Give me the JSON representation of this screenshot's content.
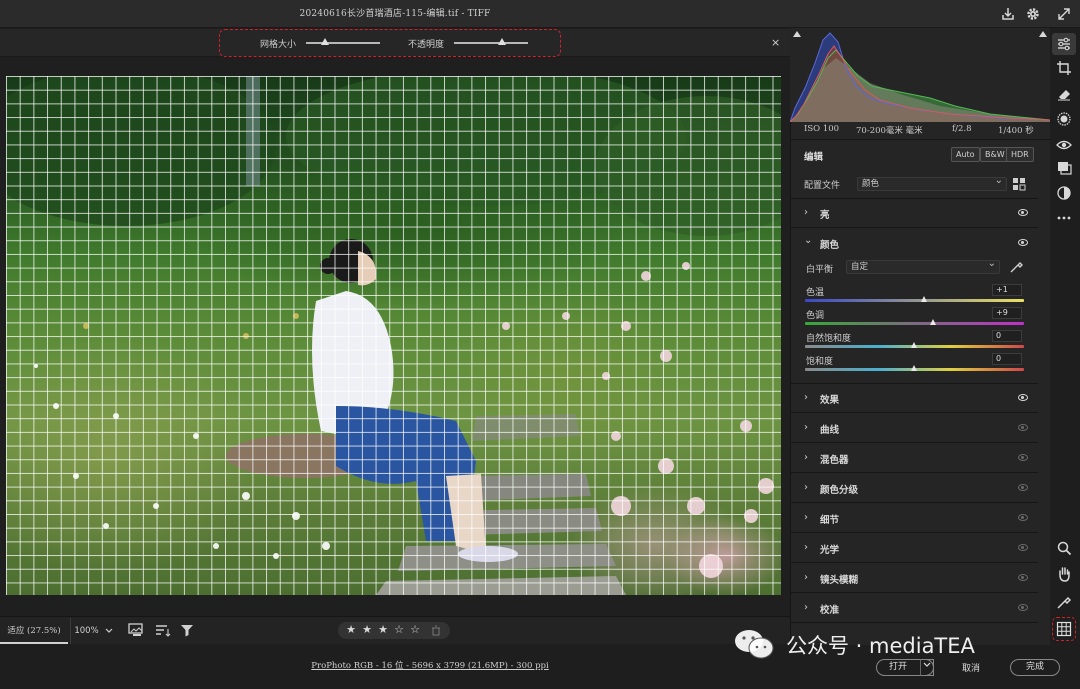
{
  "window": {
    "title": "20240616长沙首瑞酒店-115-编辑.tif -  TIFF"
  },
  "overlay": {
    "grid_size_label": "网格大小",
    "grid_size_value": 0.25,
    "opacity_label": "不透明度",
    "opacity_value": 0.65,
    "close_glyph": "×"
  },
  "histogram": {
    "iso": "ISO 100",
    "lens": "70-200毫米 毫米",
    "aperture": "f/2.8",
    "shutter": "1/400 秒"
  },
  "edit": {
    "title": "编辑",
    "auto": "Auto",
    "bw": "B&W",
    "hdr": "HDR",
    "profile_label": "配置文件",
    "profile_value": "颜色"
  },
  "sections": {
    "light": "亮",
    "color": "颜色",
    "effects": "效果",
    "curves": "曲线",
    "mixer": "混色器",
    "color_grading": "颜色分级",
    "detail": "细节",
    "optics": "光学",
    "lens_blur": "镜头模糊",
    "calibration": "校准"
  },
  "color": {
    "wb_label": "白平衡",
    "wb_value": "自定",
    "temp_label": "色温",
    "temp_value": "+1",
    "temp_pos": 0.55,
    "tint_label": "色调",
    "tint_value": "+9",
    "tint_pos": 0.59,
    "vibrance_label": "自然饱和度",
    "vibrance_value": "0",
    "vibrance_pos": 0.5,
    "saturation_label": "饱和度",
    "saturation_value": "0",
    "saturation_pos": 0.5
  },
  "bottom": {
    "fit": "适应 (27.5%)",
    "zoom": "100%",
    "stars": [
      "★",
      "★",
      "★",
      "☆",
      "☆"
    ],
    "rating": 3
  },
  "footer": {
    "file_info": "ProPhoto RGB - 16 位 - 5696 x 3799 (21.6MP) - 300 ppi",
    "open": "打开",
    "cancel": "取消",
    "done": "完成"
  },
  "watermark": "公众号 · mediaTEA",
  "colors": {
    "accent_red": "#d0202a",
    "panel_bg": "#252525"
  },
  "icons": {
    "export": "export-icon",
    "settings": "gear-icon",
    "expand": "expand-icon",
    "edit_sliders": "sliders-icon",
    "crop": "crop-icon",
    "eraser": "eraser-icon",
    "masking": "mask-icon",
    "redeye": "eye-icon",
    "presets": "presets-icon",
    "versions": "versions-icon",
    "more": "more-icon",
    "zoom": "zoom-icon",
    "hand": "hand-icon",
    "sampler": "eyedropper-icon",
    "grid": "grid-icon"
  }
}
